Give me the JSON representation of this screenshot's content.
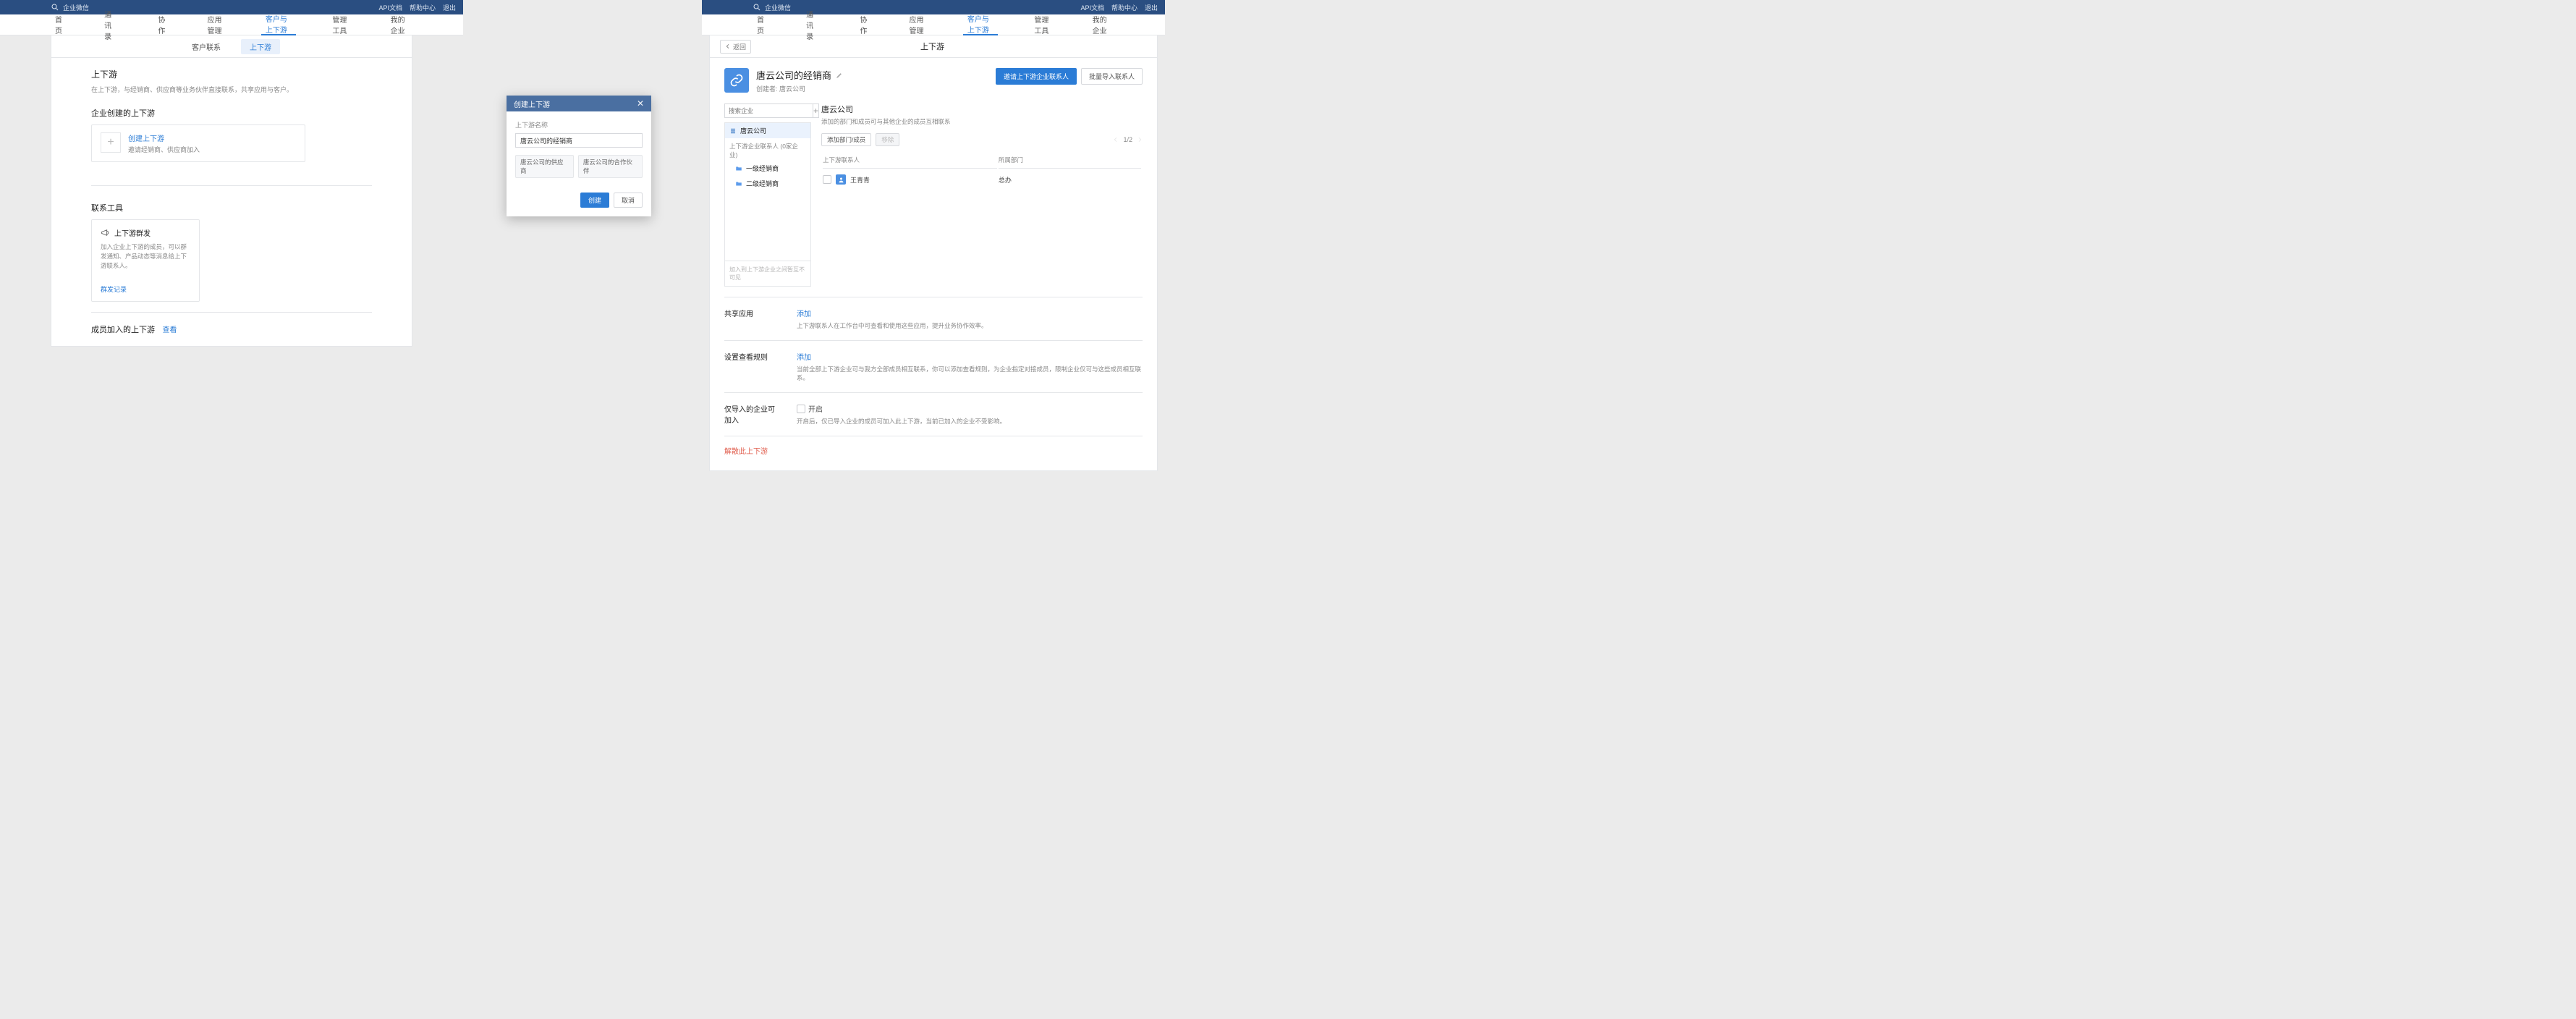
{
  "topbar": {
    "brand": "企业微信",
    "links": [
      "API文档",
      "帮助中心",
      "退出"
    ]
  },
  "nav": [
    "首页",
    "通讯录",
    "协作",
    "应用管理",
    "客户与上下游",
    "管理工具",
    "我的企业"
  ],
  "nav_active_index": 4,
  "left": {
    "subtabs": [
      "客户联系",
      "上下游"
    ],
    "subtab_active_index": 1,
    "title": "上下游",
    "desc": "在上下游，与经销商、供应商等业务伙伴直接联系，共享应用与客户。",
    "create_section": "企业创建的上下游",
    "create": {
      "title": "创建上下游",
      "desc": "邀请经销商、供应商加入"
    },
    "tools_section": "联系工具",
    "tool": {
      "title": "上下游群发",
      "desc": "加入企业上下游的成员，可以群发通知、产品动态等消息给上下游联系人。",
      "link": "群发记录"
    },
    "joined_section": "成员加入的上下游",
    "view": "查看"
  },
  "dialog": {
    "title": "创建上下游",
    "field_label": "上下游名称",
    "field_value": "唐云公司的经销商",
    "tags": [
      "唐云公司的供应商",
      "唐云公司的合作伙伴"
    ],
    "ok": "创建",
    "cancel": "取消"
  },
  "right": {
    "back": "返回",
    "page_title": "上下游",
    "name": "唐云公司的经销商",
    "creator": "创建者: 唐云公司",
    "btn_invite": "邀请上下游企业联系人",
    "btn_import": "批量导入联系人",
    "search_placeholder": "搜索企业",
    "root_node": "唐云公司",
    "tree_section_label": "上下游企业联系人 (0家企业)",
    "tree_nodes": [
      "一级经销商",
      "二级经销商"
    ],
    "tree_foot": "加入到上下游企业之间暂互不可见",
    "org_name": "唐云公司",
    "org_desc": "添加的部门和成员可与其他企业的成员互相联系",
    "btn_add_member": "添加部门/成员",
    "btn_move": "移除",
    "pager": "1/2",
    "col_contact": "上下游联系人",
    "col_dept": "所属部门",
    "contact_name": "王青青",
    "contact_dept": "总办",
    "share_label": "共享应用",
    "add_link": "添加",
    "share_note": "上下游联系人在工作台中可查看和使用这些应用，提升业务协作效率。",
    "rules_label": "设置查看规则",
    "rules_note": "当前全部上下游企业可与我方全部成员相互联系，你可以添加查看规则，为企业指定对接成员，限制企业仅可与这些成员相互联系。",
    "only_label": "仅导入的企业可加入",
    "only_toggle": "开启",
    "only_note": "开启后，仅已导入企业的成员可加入此上下游，当前已加入的企业不受影响。",
    "dissolve": "解散此上下游"
  }
}
